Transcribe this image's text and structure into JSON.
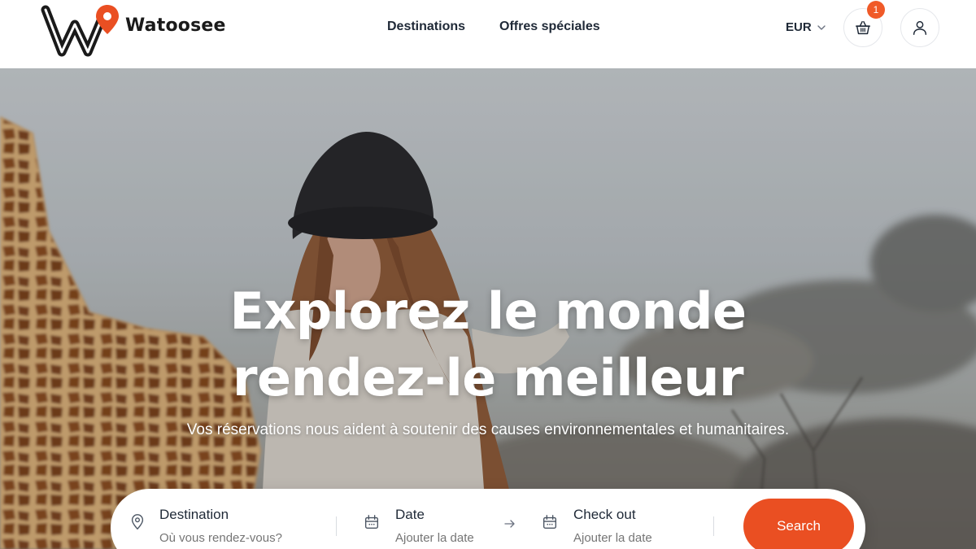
{
  "brand": {
    "name": "Watoosee",
    "accent": "#ea4f22"
  },
  "nav": {
    "items": [
      {
        "label": "Destinations"
      },
      {
        "label": "Offres spéciales"
      }
    ]
  },
  "currency": {
    "label": "EUR",
    "icon": "chevron-down-icon"
  },
  "cart": {
    "count": "1",
    "icon": "basket-icon"
  },
  "account": {
    "icon": "user-icon"
  },
  "hero": {
    "title_line1": "Explorez le monde",
    "title_line2": "rendez-le meilleur",
    "subtitle": "Vos réservations nous aident à soutenir des causes environnementales et humanitaires."
  },
  "search": {
    "destination": {
      "label": "Destination",
      "placeholder": "Où vous rendez-vous?",
      "icon": "map-pin-icon"
    },
    "date": {
      "label": "Date",
      "placeholder": "Ajouter la date",
      "icon": "calendar-icon"
    },
    "checkout": {
      "label": "Check out",
      "placeholder": "Ajouter la date",
      "icon": "calendar-icon"
    },
    "button_label": "Search"
  }
}
